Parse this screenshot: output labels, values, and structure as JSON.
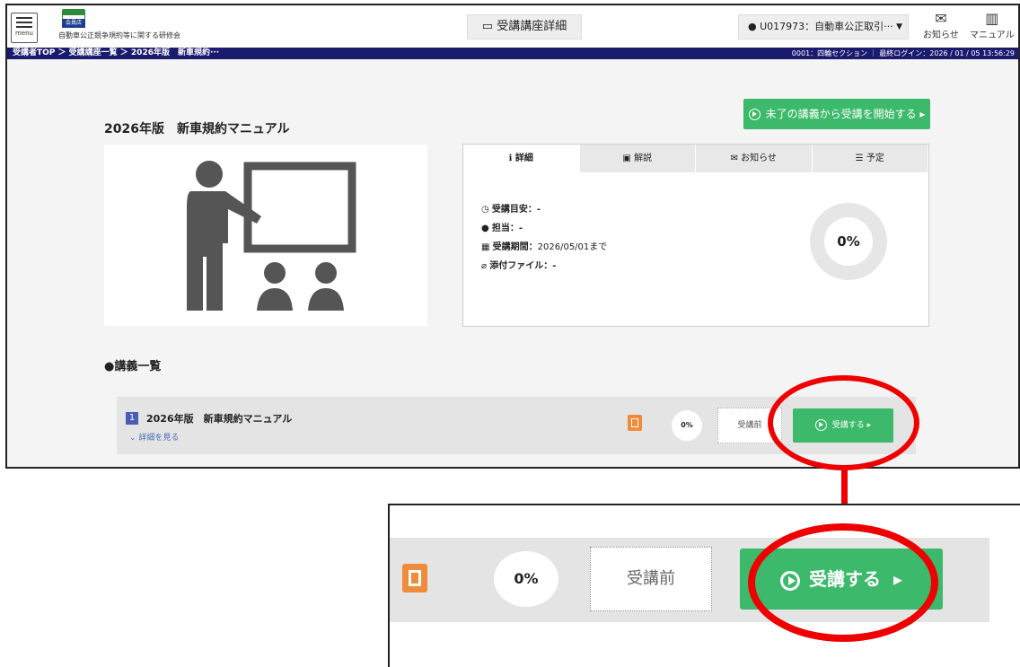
{
  "header": {
    "menu_label": "menu",
    "logo_badge": "会員店",
    "org_name": "自動車公正競争規約等に関する研修会",
    "screen_title": "受講講座詳細",
    "user_label": "U017973：自動車公正取引···",
    "notice_label": "お知らせ",
    "manual_label": "マニュアル"
  },
  "navbar": {
    "breadcrumb": "受講者TOP ＞ 受講講座一覧 ＞ 2026年版　新車規約···",
    "section_info": "0001：四輪セクション ｜ 最終ログイン：2026 / 01 / 05 13:56:29"
  },
  "main": {
    "start_button": "未了の講義から受講を開始する",
    "course_title": "2026年版　新車規約マニュアル",
    "tabs": [
      {
        "label": "詳細",
        "icon": "info-icon"
      },
      {
        "label": "解説",
        "icon": "document-icon"
      },
      {
        "label": "お知らせ",
        "icon": "mail-icon"
      },
      {
        "label": "予定",
        "icon": "list-icon"
      }
    ],
    "info": {
      "duration_label": "受講目安：-",
      "owner_label": "担当：-",
      "period_label": "受講期間：",
      "period_value": "2026/05/01まで",
      "attachment_label": "添付ファイル：-"
    },
    "progress_percent": "0%",
    "lecture_list_title": "●講義一覧",
    "lesson": {
      "number": "1",
      "title": "2026年版　新車規約マニュアル",
      "detail_link": "詳細を見る",
      "progress": "0%",
      "status": "受講前",
      "take_button": "受講する"
    }
  },
  "zoom": {
    "progress": "0%",
    "status": "受講前",
    "take_button": "受講する"
  },
  "colors": {
    "accent_green": "#3cb96a",
    "nav_blue": "#1a1a6e",
    "annotation_red": "#e00000",
    "ppt_orange": "#f08b3a"
  }
}
